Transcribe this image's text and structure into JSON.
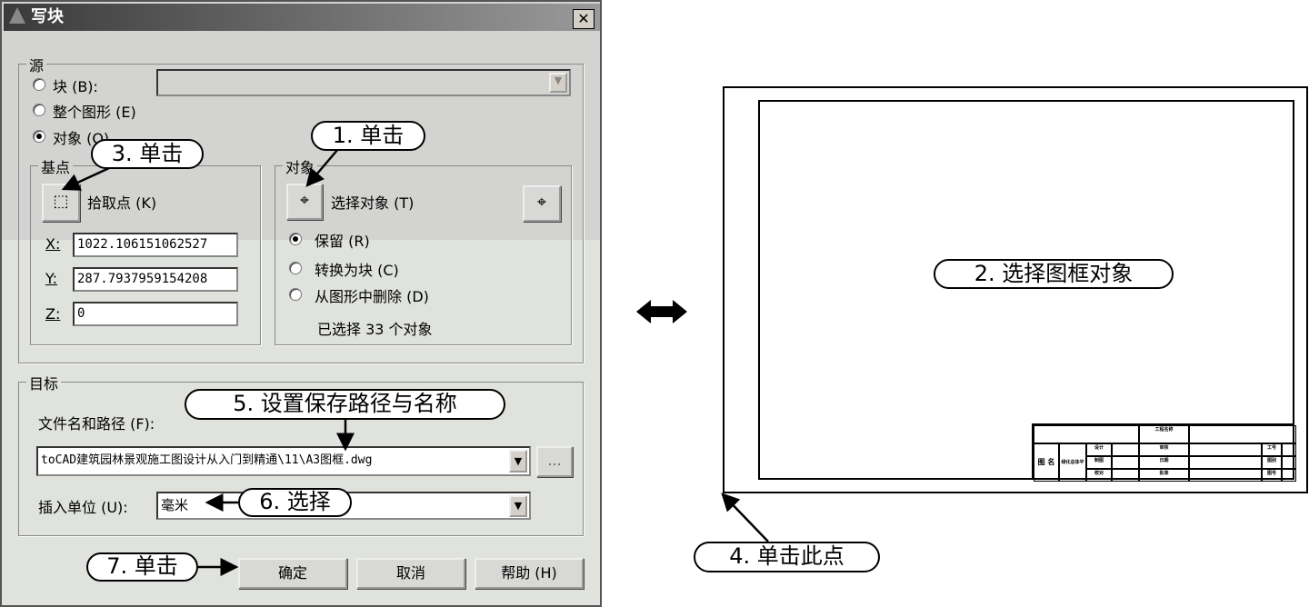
{
  "dialog": {
    "title": "写块",
    "close": "✕",
    "source": {
      "label": "源",
      "block": "块 (B):",
      "entire": "整个图形 (E)",
      "objects": "对象 (O)",
      "selected": "objects"
    },
    "base_point": {
      "label": "基点",
      "pick": "拾取点 (K)",
      "x_label": "X:",
      "x": "1022.106151062527",
      "y_label": "Y:",
      "y": "287.7937959154208",
      "z_label": "Z:",
      "z": "0"
    },
    "objects": {
      "label": "对象",
      "select": "选择对象 (T)",
      "retain": "保留 (R)",
      "convert": "转换为块 (C)",
      "delete": "从图形中删除 (D)",
      "status": "已选择 33 个对象",
      "selected_option": "retain"
    },
    "destination": {
      "label": "目标",
      "file_label": "文件名和路径 (F):",
      "file_value": "toCAD建筑园林景观施工图设计从入门到精通\\11\\A3图框.dwg",
      "browse": "...",
      "units_label": "插入单位 (U):",
      "units_value": "毫米"
    },
    "buttons": {
      "ok": "确定",
      "cancel": "取消",
      "help": "帮助 (H)"
    }
  },
  "callouts": {
    "c1": "1. 单击",
    "c2": "2. 选择图框对象",
    "c3": "3. 单击",
    "c4": "4. 单击此点",
    "c5": "5. 设置保存路径与名称",
    "c6": "6. 选择",
    "c7": "7. 单击"
  },
  "title_block": {
    "project": "工程名称",
    "drawing_name": "图 名",
    "drawing_title": "绿化总体平面图",
    "left": [
      "设计",
      "制图",
      "校对"
    ],
    "mid": [
      "审核",
      "日期",
      "批准"
    ],
    "right": [
      "工号",
      "图别",
      "图号"
    ]
  }
}
